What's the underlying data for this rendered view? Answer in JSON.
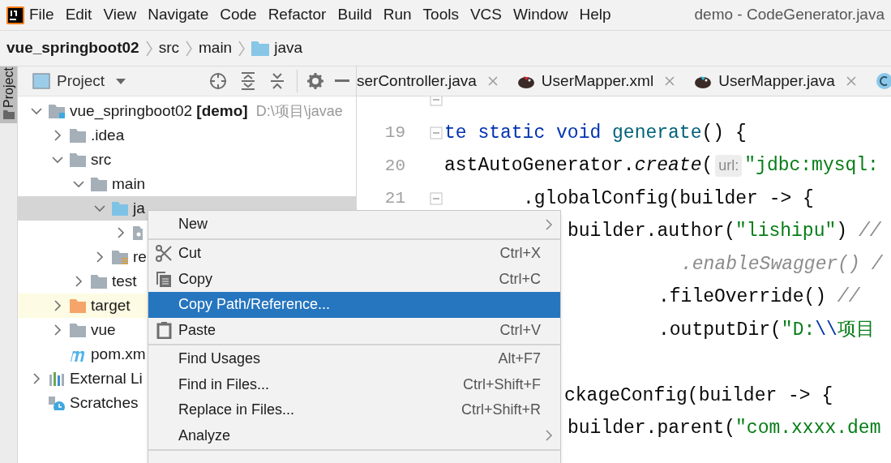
{
  "menu_bar": {
    "items": [
      "File",
      "Edit",
      "View",
      "Navigate",
      "Code",
      "Refactor",
      "Build",
      "Run",
      "Tools",
      "VCS",
      "Window",
      "Help"
    ],
    "title": "demo - CodeGenerator.java"
  },
  "breadcrumbs": [
    {
      "label": "vue_springboot02",
      "kind": "project"
    },
    {
      "label": "src",
      "kind": "plain"
    },
    {
      "label": "main",
      "kind": "plain"
    },
    {
      "label": "java",
      "kind": "folder"
    }
  ],
  "side_stripe": {
    "label": "Project",
    "selected": true
  },
  "project_panel": {
    "title": "Project",
    "tree": [
      {
        "label": "vue_springboot02 **[demo]**",
        "path": "D:\\项目\\javae",
        "kind": "module",
        "expanded": true,
        "selected": false,
        "children": [
          {
            "label": ".idea",
            "kind": "folder",
            "expanded": false,
            "selected": false
          },
          {
            "label": "src",
            "kind": "folder",
            "expanded": true,
            "selected": false,
            "children": [
              {
                "label": "main",
                "kind": "folder",
                "expanded": true,
                "selected": false,
                "children": [
                  {
                    "label": "ja",
                    "kind": "source",
                    "expanded": true,
                    "selected": true,
                    "children": [
                      {
                        "kind": "package",
                        "expanded": false,
                        "selected": false
                      }
                    ]
                  },
                  {
                    "label": "re",
                    "kind": "resources",
                    "expanded": false,
                    "selected": false
                  }
                ]
              },
              {
                "label": "test",
                "kind": "folder",
                "expanded": false,
                "selected": false
              }
            ]
          },
          {
            "label": "target",
            "kind": "excluded",
            "expanded": false,
            "selected": false
          },
          {
            "label": "vue",
            "kind": "folder",
            "expanded": false,
            "selected": false
          },
          {
            "label": "pom.xm",
            "kind": "maven",
            "selected": false
          }
        ]
      },
      {
        "label": "External Li",
        "kind": "libraries",
        "expanded": false,
        "selected": false
      },
      {
        "label": "Scratches",
        "kind": "scratches",
        "selected": false
      }
    ]
  },
  "editor_tabs": [
    {
      "label": "serController.java",
      "kind": "plain"
    },
    {
      "label": "UserMapper.xml",
      "kind": "mapper-xml"
    },
    {
      "label": "UserMapper.java",
      "kind": "mapper-java"
    },
    {
      "kind": "class"
    }
  ],
  "code_lines": [
    {
      "fold_marker": true
    },
    {
      "number": "19",
      "fold_marker": true,
      "tokens": [
        {
          "text": "te static void ",
          "kind": "keyword"
        },
        {
          "text": "generate",
          "kind": "method"
        },
        {
          "text": "() {",
          "kind": "plain"
        }
      ]
    },
    {
      "number": "20",
      "fold_marker": false,
      "tokens": [
        {
          "text": "astAutoGenerator.",
          "kind": "plain"
        },
        {
          "text": "create",
          "kind": "italic"
        },
        {
          "text": "(",
          "kind": "plain"
        },
        {
          "text": "url:",
          "kind": "hint"
        },
        {
          "text": "\"jdbc:mysql:",
          "kind": "string"
        }
      ]
    },
    {
      "number": "21",
      "fold_marker": true,
      "tokens": [
        {
          "text": ".globalConfig(builder -> {",
          "kind": "plain"
        }
      ]
    },
    {
      "tokens": [
        {
          "text": "builder.author(",
          "kind": "plain"
        },
        {
          "text": "\"lishipu\"",
          "kind": "string"
        },
        {
          "text": ") ",
          "kind": "plain"
        },
        {
          "text": "//",
          "kind": "comment"
        }
      ]
    },
    {
      "tokens": [
        {
          "text": ".enableSwagger() /",
          "kind": "comment"
        }
      ]
    },
    {
      "tokens": [
        {
          "text": ".fileOverride() ",
          "kind": "plain"
        },
        {
          "text": "//",
          "kind": "comment"
        }
      ]
    },
    {
      "tokens": [
        {
          "text": ".outputDir(",
          "kind": "plain"
        },
        {
          "text": "\"D:",
          "kind": "string"
        },
        {
          "text": "\\\\",
          "kind": "escape"
        },
        {
          "text": "项目",
          "kind": "string"
        }
      ]
    },
    {
      "tokens": [
        {
          "text": "ckageConfig(builder -> {",
          "kind": "plain"
        }
      ]
    },
    {
      "tokens": [
        {
          "text": "builder.parent(",
          "kind": "plain"
        },
        {
          "text": "\"com.xxxx.dem",
          "kind": "string"
        }
      ]
    }
  ],
  "context_menu": {
    "groups": [
      [
        {
          "label": "New",
          "submenu": true,
          "selected": false
        }
      ],
      [
        {
          "label": "Cut",
          "kind": "cut",
          "shortcut": "Ctrl+X",
          "submenu": false,
          "selected": false
        },
        {
          "label": "Copy",
          "kind": "copy",
          "shortcut": "Ctrl+C",
          "submenu": false,
          "selected": false
        },
        {
          "label": "Copy Path/Reference...",
          "submenu": false,
          "selected": true
        },
        {
          "label": "Paste",
          "kind": "paste",
          "shortcut": "Ctrl+V",
          "submenu": false,
          "selected": false
        }
      ],
      [
        {
          "label": "Find Usages",
          "shortcut": "Alt+F7",
          "submenu": false,
          "selected": false
        },
        {
          "label": "Find in Files...",
          "shortcut": "Ctrl+Shift+F",
          "submenu": false,
          "selected": false
        },
        {
          "label": "Replace in Files...",
          "shortcut": "Ctrl+Shift+R",
          "submenu": false,
          "selected": false
        },
        {
          "label": "Analyze",
          "submenu": true,
          "selected": false
        }
      ]
    ]
  }
}
